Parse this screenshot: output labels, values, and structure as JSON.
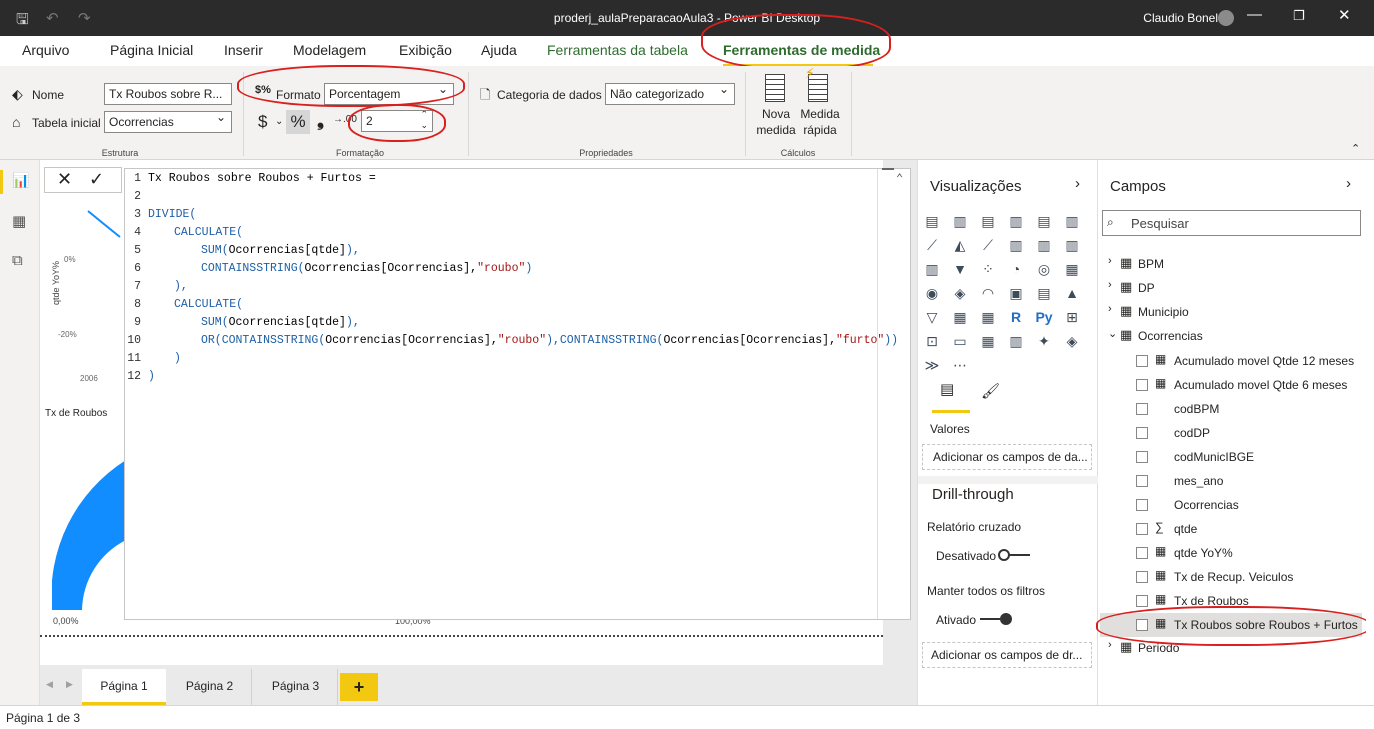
{
  "title_bar": {
    "title": "proderj_aulaPreparacaoAula3 - Power BI Desktop",
    "user": "Claudio Bonel"
  },
  "menu": {
    "items": [
      "Arquivo",
      "Página Inicial",
      "Inserir",
      "Modelagem",
      "Exibição",
      "Ajuda",
      "Ferramentas da tabela",
      "Ferramentas de medida"
    ]
  },
  "ribbon": {
    "estrutura": {
      "nome_label": "Nome",
      "nome_value": "Tx Roubos sobre R...",
      "tabela_label": "Tabela inicial",
      "tabela_value": "Ocorrencias",
      "group_label": "Estrutura"
    },
    "formatacao": {
      "formato_label": "Formato",
      "formato_value": "Porcentagem",
      "currency_symbol": "$",
      "percent_symbol": "%",
      "comma_symbol": "❟",
      "decimals_value": "2",
      "group_label": "Formatação"
    },
    "propriedades": {
      "categoria_label": "Categoria de dados",
      "categoria_value": "Não categorizado",
      "group_label": "Propriedades"
    },
    "calculos": {
      "nova_medida": [
        "Nova",
        "medida"
      ],
      "medida_rapida": [
        "Medida",
        "rápida"
      ],
      "group_label": "Cálculos"
    }
  },
  "editor": {
    "lines": [
      "1",
      "2",
      "3",
      "4",
      "5",
      "6",
      "7",
      "8",
      "9",
      "10",
      "11",
      "12"
    ],
    "code": {
      "l1": "Tx Roubos sobre Roubos + Furtos =",
      "l3": "DIVIDE(",
      "l4": "CALCULATE(",
      "l5a": "SUM(",
      "l5b": "Ocorrencias[qtde]",
      "l5c": "),",
      "l6a": "CONTAINSSTRING(",
      "l6b": "Ocorrencias[Ocorrencias],",
      "l6c": "\"roubo\"",
      "l6d": ")",
      "l7": "),",
      "l8": "CALCULATE(",
      "l9a": "SUM(",
      "l9b": "Ocorrencias[qtde]",
      "l9c": "),",
      "l10a": "OR(",
      "l10b": "CONTAINSSTRING(",
      "l10c": "Ocorrencias[Ocorrencias],",
      "l10d": "\"roubo\"",
      "l10e": "),",
      "l10f": "CONTAINSSTRING(",
      "l10g": "Ocorrencias[Ocorrencias],",
      "l10h": "\"furto\"",
      "l10i": "))",
      "l11": ")",
      "l12": ")"
    }
  },
  "canvas": {
    "y_axis_label": "qtde YoY%",
    "tick_0": "0%",
    "tick_minus20": "-20%",
    "year": "2006",
    "gauge_title": "Tx de Roubos",
    "gauge_min": "0,00%",
    "gauge_max": "100,00%"
  },
  "tabs": {
    "pages": [
      "Página 1",
      "Página 2",
      "Página 3"
    ],
    "add": "+"
  },
  "status_bar": {
    "text": "Página 1 de 3"
  },
  "visualizations": {
    "title": "Visualizações",
    "valores_label": "Valores",
    "valores_placeholder": "Adicionar os campos de da...",
    "drill_title": "Drill-through",
    "cruzado_label": "Relatório cruzado",
    "cruzado_state": "Desativado",
    "manter_label": "Manter todos os filtros",
    "manter_state": "Ativado",
    "drill_placeholder": "Adicionar os campos de dr..."
  },
  "fields": {
    "title": "Campos",
    "search_placeholder": "Pesquisar",
    "tables": [
      "BPM",
      "DP",
      "Municipio",
      "Ocorrencias"
    ],
    "ocorrencias_fields": [
      "Acumulado movel Qtde 12 meses",
      "Acumulado movel Qtde 6 meses",
      "codBPM",
      "codDP",
      "codMunicIBGE",
      "mes_ano",
      "Ocorrencias",
      "qtde",
      "qtde YoY%",
      "Tx de Recup. Veiculos",
      "Tx de Roubos",
      "Tx Roubos sobre Roubos + Furtos"
    ],
    "last_table": "Periodo"
  },
  "colors": {
    "accent_yellow": "#f2c811",
    "annotation_red": "#d9201e",
    "gauge_blue": "#118dff",
    "code_keyword": "#1d5fa7",
    "code_string": "#a31515"
  }
}
